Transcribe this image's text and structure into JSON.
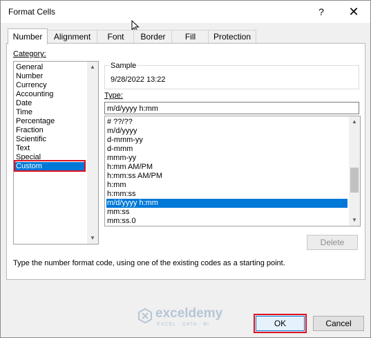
{
  "window": {
    "title": "Format Cells",
    "help": "?",
    "close": "✕"
  },
  "tabs": [
    "Number",
    "Alignment",
    "Font",
    "Border",
    "Fill",
    "Protection"
  ],
  "category": {
    "label": "Category:",
    "items": [
      "General",
      "Number",
      "Currency",
      "Accounting",
      "Date",
      "Time",
      "Percentage",
      "Fraction",
      "Scientific",
      "Text",
      "Special",
      "Custom"
    ],
    "selected": "Custom"
  },
  "sample": {
    "label": "Sample",
    "value": "9/28/2022 13:22"
  },
  "type": {
    "label": "Type:",
    "value": "m/d/yyyy h:mm",
    "list": [
      "# ??/??",
      "m/d/yyyy",
      "d-mmm-yy",
      "d-mmm",
      "mmm-yy",
      "h:mm AM/PM",
      "h:mm:ss AM/PM",
      "h:mm",
      "h:mm:ss",
      "m/d/yyyy h:mm",
      "mm:ss",
      "mm:ss.0"
    ],
    "selected": "m/d/yyyy h:mm"
  },
  "buttons": {
    "delete": "Delete",
    "ok": "OK",
    "cancel": "Cancel"
  },
  "hint": "Type the number format code, using one of the existing codes as a starting point.",
  "watermark": {
    "name": "exceldemy",
    "tagline": "EXCEL · DATA · BI"
  },
  "colors": {
    "selection": "#0078d7",
    "highlight_box": "#e0121f",
    "watermark": "#b6c6d6"
  }
}
